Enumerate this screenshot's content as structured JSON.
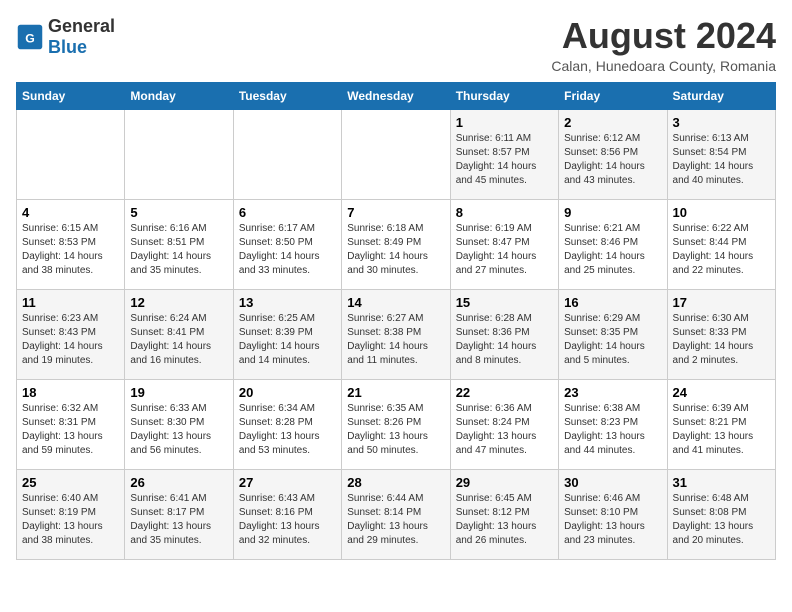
{
  "logo": {
    "general": "General",
    "blue": "Blue"
  },
  "title": "August 2024",
  "location": "Calan, Hunedoara County, Romania",
  "weekdays": [
    "Sunday",
    "Monday",
    "Tuesday",
    "Wednesday",
    "Thursday",
    "Friday",
    "Saturday"
  ],
  "weeks": [
    [
      {
        "day": "",
        "info": ""
      },
      {
        "day": "",
        "info": ""
      },
      {
        "day": "",
        "info": ""
      },
      {
        "day": "",
        "info": ""
      },
      {
        "day": "1",
        "info": "Sunrise: 6:11 AM\nSunset: 8:57 PM\nDaylight: 14 hours and 45 minutes."
      },
      {
        "day": "2",
        "info": "Sunrise: 6:12 AM\nSunset: 8:56 PM\nDaylight: 14 hours and 43 minutes."
      },
      {
        "day": "3",
        "info": "Sunrise: 6:13 AM\nSunset: 8:54 PM\nDaylight: 14 hours and 40 minutes."
      }
    ],
    [
      {
        "day": "4",
        "info": "Sunrise: 6:15 AM\nSunset: 8:53 PM\nDaylight: 14 hours and 38 minutes."
      },
      {
        "day": "5",
        "info": "Sunrise: 6:16 AM\nSunset: 8:51 PM\nDaylight: 14 hours and 35 minutes."
      },
      {
        "day": "6",
        "info": "Sunrise: 6:17 AM\nSunset: 8:50 PM\nDaylight: 14 hours and 33 minutes."
      },
      {
        "day": "7",
        "info": "Sunrise: 6:18 AM\nSunset: 8:49 PM\nDaylight: 14 hours and 30 minutes."
      },
      {
        "day": "8",
        "info": "Sunrise: 6:19 AM\nSunset: 8:47 PM\nDaylight: 14 hours and 27 minutes."
      },
      {
        "day": "9",
        "info": "Sunrise: 6:21 AM\nSunset: 8:46 PM\nDaylight: 14 hours and 25 minutes."
      },
      {
        "day": "10",
        "info": "Sunrise: 6:22 AM\nSunset: 8:44 PM\nDaylight: 14 hours and 22 minutes."
      }
    ],
    [
      {
        "day": "11",
        "info": "Sunrise: 6:23 AM\nSunset: 8:43 PM\nDaylight: 14 hours and 19 minutes."
      },
      {
        "day": "12",
        "info": "Sunrise: 6:24 AM\nSunset: 8:41 PM\nDaylight: 14 hours and 16 minutes."
      },
      {
        "day": "13",
        "info": "Sunrise: 6:25 AM\nSunset: 8:39 PM\nDaylight: 14 hours and 14 minutes."
      },
      {
        "day": "14",
        "info": "Sunrise: 6:27 AM\nSunset: 8:38 PM\nDaylight: 14 hours and 11 minutes."
      },
      {
        "day": "15",
        "info": "Sunrise: 6:28 AM\nSunset: 8:36 PM\nDaylight: 14 hours and 8 minutes."
      },
      {
        "day": "16",
        "info": "Sunrise: 6:29 AM\nSunset: 8:35 PM\nDaylight: 14 hours and 5 minutes."
      },
      {
        "day": "17",
        "info": "Sunrise: 6:30 AM\nSunset: 8:33 PM\nDaylight: 14 hours and 2 minutes."
      }
    ],
    [
      {
        "day": "18",
        "info": "Sunrise: 6:32 AM\nSunset: 8:31 PM\nDaylight: 13 hours and 59 minutes."
      },
      {
        "day": "19",
        "info": "Sunrise: 6:33 AM\nSunset: 8:30 PM\nDaylight: 13 hours and 56 minutes."
      },
      {
        "day": "20",
        "info": "Sunrise: 6:34 AM\nSunset: 8:28 PM\nDaylight: 13 hours and 53 minutes."
      },
      {
        "day": "21",
        "info": "Sunrise: 6:35 AM\nSunset: 8:26 PM\nDaylight: 13 hours and 50 minutes."
      },
      {
        "day": "22",
        "info": "Sunrise: 6:36 AM\nSunset: 8:24 PM\nDaylight: 13 hours and 47 minutes."
      },
      {
        "day": "23",
        "info": "Sunrise: 6:38 AM\nSunset: 8:23 PM\nDaylight: 13 hours and 44 minutes."
      },
      {
        "day": "24",
        "info": "Sunrise: 6:39 AM\nSunset: 8:21 PM\nDaylight: 13 hours and 41 minutes."
      }
    ],
    [
      {
        "day": "25",
        "info": "Sunrise: 6:40 AM\nSunset: 8:19 PM\nDaylight: 13 hours and 38 minutes."
      },
      {
        "day": "26",
        "info": "Sunrise: 6:41 AM\nSunset: 8:17 PM\nDaylight: 13 hours and 35 minutes."
      },
      {
        "day": "27",
        "info": "Sunrise: 6:43 AM\nSunset: 8:16 PM\nDaylight: 13 hours and 32 minutes."
      },
      {
        "day": "28",
        "info": "Sunrise: 6:44 AM\nSunset: 8:14 PM\nDaylight: 13 hours and 29 minutes."
      },
      {
        "day": "29",
        "info": "Sunrise: 6:45 AM\nSunset: 8:12 PM\nDaylight: 13 hours and 26 minutes."
      },
      {
        "day": "30",
        "info": "Sunrise: 6:46 AM\nSunset: 8:10 PM\nDaylight: 13 hours and 23 minutes."
      },
      {
        "day": "31",
        "info": "Sunrise: 6:48 AM\nSunset: 8:08 PM\nDaylight: 13 hours and 20 minutes."
      }
    ]
  ]
}
